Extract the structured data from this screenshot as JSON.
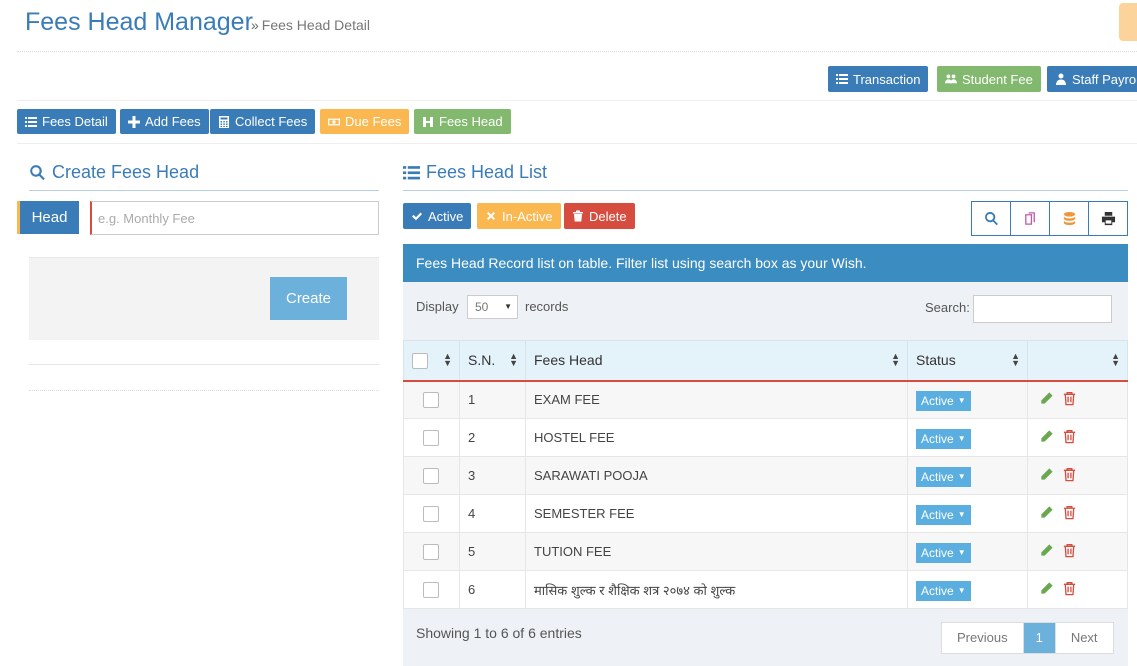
{
  "header": {
    "title": "Fees Head Manager",
    "breadcrumb_sep": "»",
    "breadcrumb": "Fees Head Detail"
  },
  "top_nav": [
    {
      "label": "Transaction",
      "icon": "list-icon",
      "color": "#3a7cb7"
    },
    {
      "label": "Student Fee",
      "icon": "users-icon",
      "color": "#82b96e"
    },
    {
      "label": "Staff Payro",
      "icon": "user-icon",
      "color": "#3a7cb7"
    }
  ],
  "sub_nav": [
    {
      "label": "Fees Detail",
      "icon": "list-icon",
      "color": "#3a7cb7"
    },
    {
      "label": "Add Fees",
      "icon": "plus-icon",
      "color": "#3a7cb7"
    },
    {
      "label": "Collect Fees",
      "icon": "calculator-icon",
      "color": "#3a7cb7"
    },
    {
      "label": "Due Fees",
      "icon": "money-icon",
      "color": "#fbb850"
    },
    {
      "label": "Fees Head",
      "icon": "h-icon",
      "color": "#82b96e"
    }
  ],
  "create_form": {
    "title": "Create Fees Head",
    "head_label": "Head",
    "head_placeholder": "e.g. Monthly Fee",
    "create_label": "Create"
  },
  "list": {
    "title": "Fees Head List",
    "actions": [
      {
        "label": "Active",
        "icon": "check-icon",
        "color": "#3a7cb7"
      },
      {
        "label": "In-Active",
        "icon": "times-icon",
        "color": "#fbb850"
      },
      {
        "label": "Delete",
        "icon": "trash-icon",
        "color": "#d64c3f"
      }
    ],
    "tools": [
      "search-icon",
      "copy-icon",
      "database-icon",
      "print-icon"
    ],
    "info": "Fees Head Record list on table. Filter list using search box as your Wish.",
    "display_label": "Display",
    "display_value": "50",
    "records_label": "records",
    "search_label": "Search:",
    "columns": [
      "",
      "S.N.",
      "Fees Head",
      "Status",
      ""
    ],
    "rows": [
      {
        "sn": "1",
        "head": "EXAM FEE",
        "status": "Active"
      },
      {
        "sn": "2",
        "head": "HOSTEL FEE",
        "status": "Active"
      },
      {
        "sn": "3",
        "head": "SARAWATI POOJA",
        "status": "Active"
      },
      {
        "sn": "4",
        "head": "SEMESTER FEE",
        "status": "Active"
      },
      {
        "sn": "5",
        "head": "TUTION FEE",
        "status": "Active"
      },
      {
        "sn": "6",
        "head": "मासिक शुल्क र शैक्षिक शत्र २०७४ को शुल्क",
        "status": "Active"
      }
    ],
    "showing": "Showing 1 to 6 of 6 entries",
    "pager": {
      "prev": "Previous",
      "current": "1",
      "next": "Next"
    }
  }
}
